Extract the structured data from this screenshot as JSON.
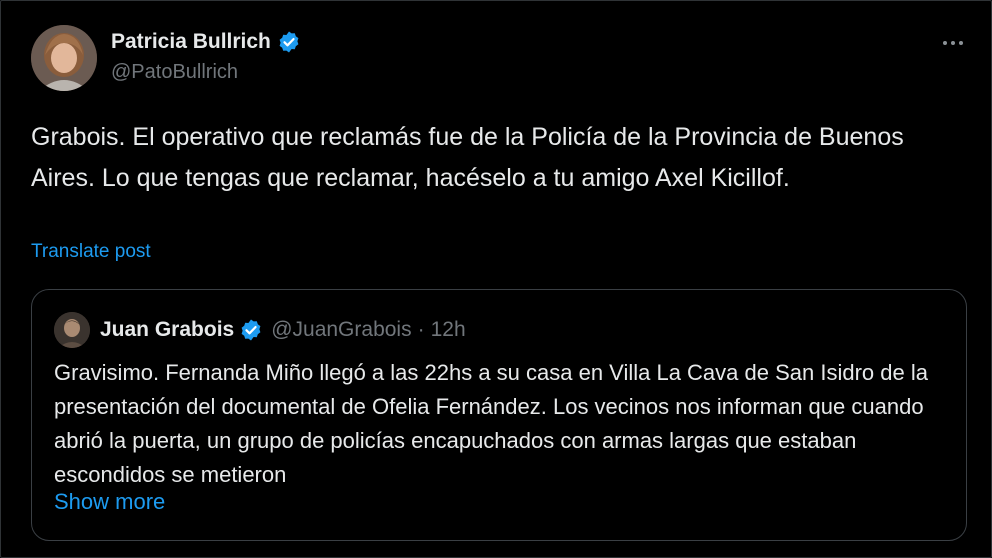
{
  "post": {
    "author": {
      "display_name": "Patricia Bullrich",
      "handle": "@PatoBullrich",
      "verified": true
    },
    "text": "Grabois. El operativo que reclamás fue de la Policía de la Provincia de Buenos Aires. Lo que tengas que reclamar, hacéselo a tu amigo Axel Kicillof.",
    "translate_label": "Translate post",
    "more_icon": "more-dots-icon"
  },
  "quote": {
    "author": {
      "display_name": "Juan Grabois",
      "handle": "@JuanGrabois",
      "verified": true
    },
    "separator": "·",
    "time": "12h",
    "text": "Gravisimo. Fernanda Miño llegó a las 22hs a su casa en Villa La Cava de San Isidro de la presentación del documental de Ofelia Fernández. Los vecinos nos informan que cuando abrió la puerta, un grupo de policías encapuchados con armas largas que estaban escondidos se metieron",
    "show_more_label": "Show more"
  },
  "colors": {
    "background": "#000000",
    "text": "#e7e9ea",
    "secondary_text": "#71767b",
    "link": "#1d9bf0",
    "verified_badge": "#1d9bf0",
    "border": "#3a3f44"
  }
}
